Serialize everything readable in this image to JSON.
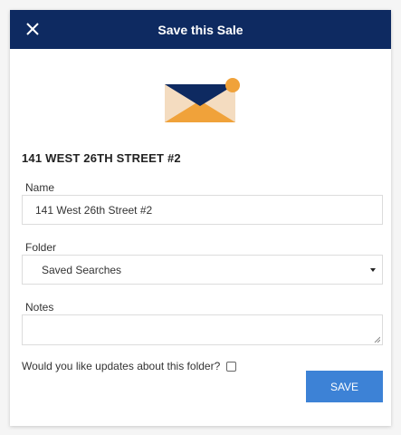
{
  "header": {
    "title": "Save this Sale",
    "close_icon": "close-icon",
    "background": "#0e2a61"
  },
  "illustration": {
    "icon": "envelope-notification-icon",
    "colors": {
      "flap": "#0e2a61",
      "body": "#f4dcc0",
      "accent": "#f0a23a"
    }
  },
  "listing": {
    "address": "141 WEST 26TH STREET #2"
  },
  "form": {
    "name_label": "Name",
    "name_value": "141 West 26th Street #2",
    "folder_label": "Folder",
    "folder_selected": "Saved Searches",
    "notes_label": "Notes",
    "notes_value": "",
    "updates_label": "Would you like updates about this folder?",
    "updates_checked": false,
    "save_label": "SAVE",
    "save_color": "#3d82d6"
  }
}
